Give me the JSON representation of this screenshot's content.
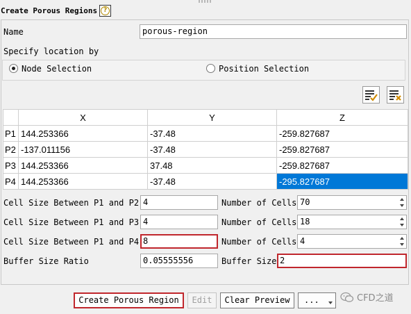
{
  "dialog": {
    "title": "Create Porous Regions",
    "help_icon": "question-circle-icon"
  },
  "name": {
    "label": "Name",
    "value": "porous-region"
  },
  "location": {
    "label": "Specify location by",
    "options": [
      {
        "label": "Node Selection",
        "selected": true
      },
      {
        "label": "Position Selection",
        "selected": false
      }
    ]
  },
  "toolbar_icons": [
    "list-check-icon",
    "list-clear-icon"
  ],
  "table": {
    "columns": [
      "X",
      "Y",
      "Z"
    ],
    "rows": [
      {
        "label": "P1",
        "x": "144.253366",
        "y": "-37.48",
        "z": "-259.827687"
      },
      {
        "label": "P2",
        "x": "-137.011156",
        "y": "-37.48",
        "z": "-259.827687"
      },
      {
        "label": "P3",
        "x": "144.253366",
        "y": "37.48",
        "z": "-259.827687"
      },
      {
        "label": "P4",
        "x": "144.253366",
        "y": "-37.48",
        "z": "-295.827687"
      }
    ],
    "selected_cell": "P4.z"
  },
  "cells": [
    {
      "label": "Cell Size Between P1 and P2",
      "value": "4",
      "count_label": "Number of Cells",
      "count": "70"
    },
    {
      "label": "Cell Size Between P1 and P3",
      "value": "4",
      "count_label": "Number of Cells",
      "count": "18"
    },
    {
      "label": "Cell Size Between P1 and P4",
      "value": "8",
      "count_label": "Number of Cells",
      "count": "4"
    }
  ],
  "buffer": {
    "ratio_label": "Buffer Size Ratio",
    "ratio_value": "0.05555556",
    "size_label": "Buffer Size",
    "size_value": "2"
  },
  "buttons": {
    "create": "Create Porous Region",
    "edit": "Edit",
    "clear_preview": "Clear Preview",
    "more": "..."
  },
  "watermark": {
    "text": "CFD之道",
    "icon": "wechat-icon"
  },
  "colors": {
    "selection": "#0078d7",
    "highlight_border": "#c0262c"
  }
}
